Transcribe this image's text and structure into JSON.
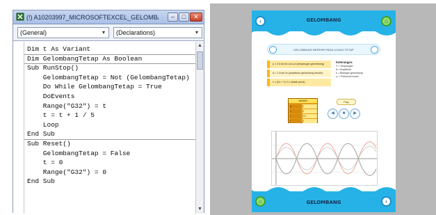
{
  "vba_editor": {
    "title": "(!) A10203997_MICROSOFTEXCEL_GELOMBAN...",
    "controls": {
      "minimize": "–",
      "maximize": "□",
      "close": "✕"
    },
    "object_combo": "(General)",
    "procedure_combo": "(Declarations)",
    "code_lines": [
      "Dim t As Variant",
      "Dim GelombangTetap As Boolean",
      "Sub RunStop()",
      "    GelombangTetap = Not (GelombangTetap)",
      "    Do While GelombangTetap = True",
      "    DoEvents",
      "    Range(\"G32\") = t",
      "    t = t + 1 / 5",
      "    Loop",
      "End Sub",
      "Sub Reset()",
      "    GelombangTetap = False",
      "    t = 0",
      "    Range(\"G32\") = 0",
      "End Sub"
    ]
  },
  "flash_app": {
    "header_title": "GELOMBANG",
    "footer_title": "GELOMBANG",
    "topic": "GELOMBANG BERDIRI PADA UJUNG TETAP",
    "equations": [
      "y = 2 A sin kx cos ωt (simpangan gelombang)",
      "A = 2 A sin kx (amplitudo gelombang berdiri)",
      "x = (2n + 1) ¼ λ (letak perut)"
    ],
    "legend_title": "Keterangan:",
    "legend_items": [
      "Y = Simpangan",
      "A = Amplitudo",
      "k = Bilangan gelombang",
      "ω = Frekuensi sudut"
    ],
    "param_title": "Variabel",
    "params": [
      {
        "key": "A",
        "value": "2"
      },
      {
        "key": "λ",
        "value": "4"
      },
      {
        "key": "f",
        "value": "0,5"
      },
      {
        "key": "t",
        "value": "0"
      }
    ],
    "play_label": "Play",
    "ctrl_icons": [
      "◀",
      "■",
      "▶"
    ],
    "colors": {
      "header": "#26b2e7",
      "home_button": "#8fe06c",
      "wave_1": "#e6a18b",
      "wave_2": "#9b9b9b"
    }
  }
}
